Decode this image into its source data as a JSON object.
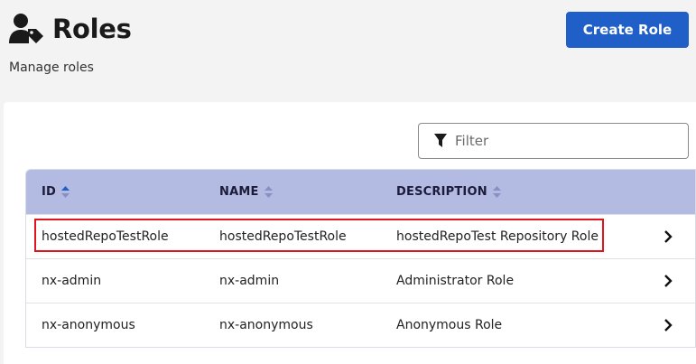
{
  "header": {
    "icon": "user-tag-icon",
    "title": "Roles",
    "subtitle": "Manage roles",
    "create_label": "Create Role",
    "accent": "#1f5fc7"
  },
  "filter": {
    "icon": "filter-funnel-icon",
    "placeholder": "Filter",
    "value": ""
  },
  "table": {
    "header_color": "#b3bbe2",
    "columns": [
      {
        "label": "ID",
        "sort": "ascending",
        "sort_icon": "sort-asc-icon"
      },
      {
        "label": "NAME",
        "sort": "none",
        "sort_icon": "sort-icon"
      },
      {
        "label": "DESCRIPTION",
        "sort": "none",
        "sort_icon": "sort-icon"
      }
    ],
    "rows": [
      {
        "id": "hostedRepoTestRole",
        "name": "hostedRepoTestRole",
        "description": "hostedRepoTest Repository Role",
        "highlighted": true
      },
      {
        "id": "nx-admin",
        "name": "nx-admin",
        "description": "Administrator Role"
      },
      {
        "id": "nx-anonymous",
        "name": "nx-anonymous",
        "description": "Anonymous Role"
      }
    ],
    "row_action_icon": "chevron-right-icon"
  },
  "annotation": {
    "highlight_color": "#e0141c"
  }
}
